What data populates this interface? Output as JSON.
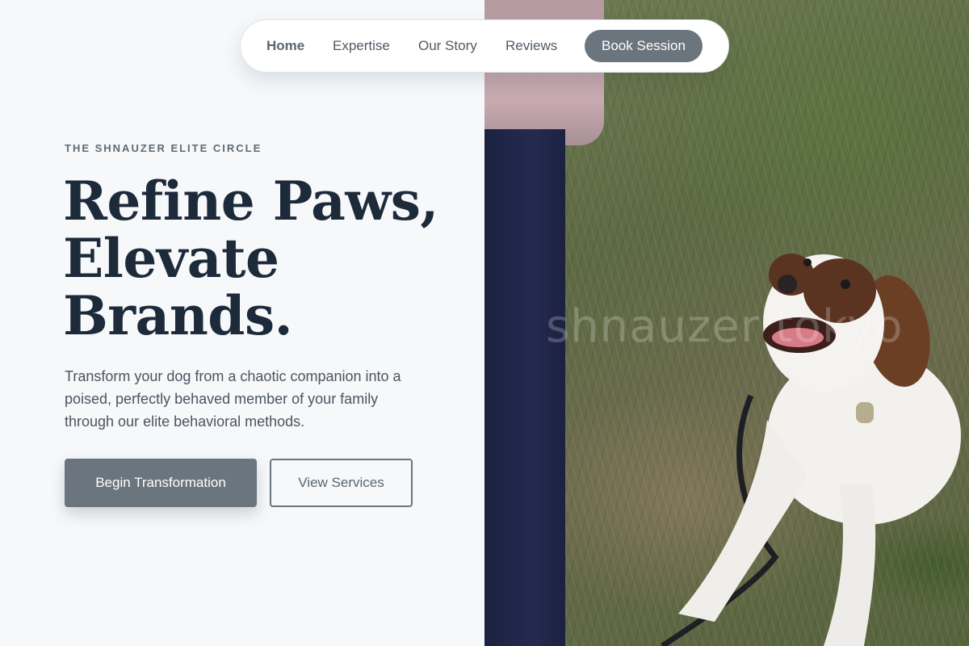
{
  "nav": {
    "links": [
      "Home",
      "Expertise",
      "Our Story",
      "Reviews"
    ],
    "active": "Home",
    "cta_label": "Book Session"
  },
  "hero": {
    "eyebrow": "THE SHNAUZER ELITE CIRCLE",
    "headline": [
      "Refine Paws,",
      "Elevate",
      "Brands."
    ],
    "subtext": "Transform your dog from a chaotic companion into a poised, perfectly behaved member of your family through our elite behavioral methods.",
    "primary_button": "Begin Transformation",
    "secondary_button": "View Services"
  },
  "photo": {
    "watermark": "shnauzer tokyo"
  },
  "colors": {
    "background": "#f6f8fa",
    "heading": "#1c2a3a",
    "accent": "#6b757d",
    "text_muted": "#4a5561"
  }
}
